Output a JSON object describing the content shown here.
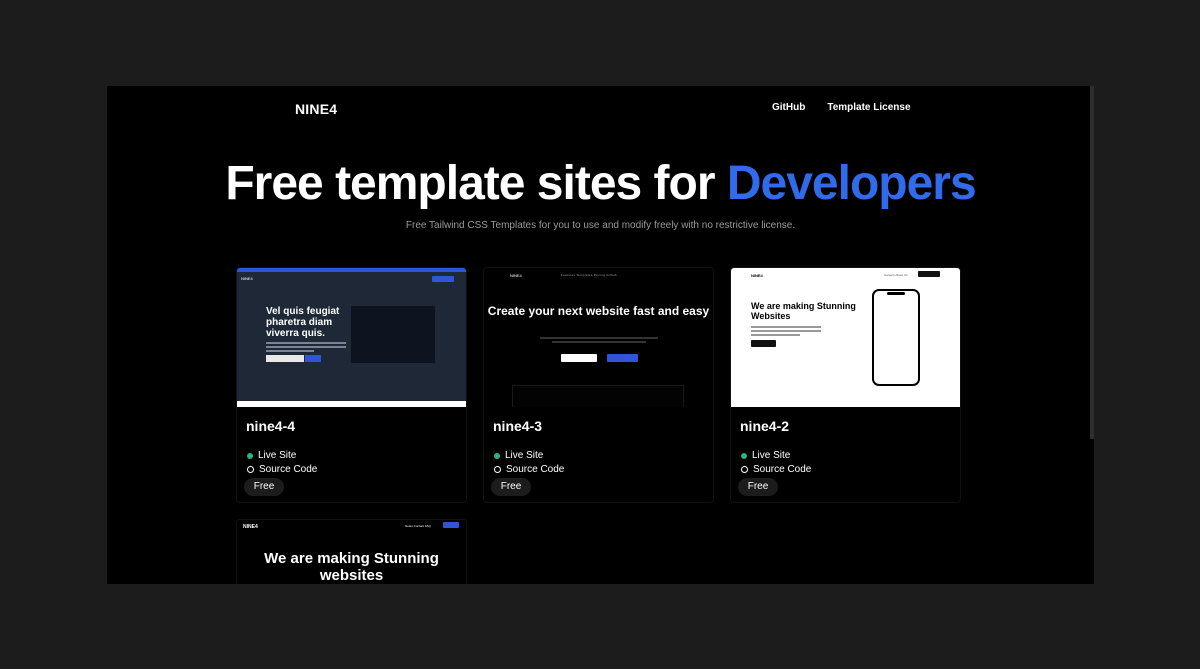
{
  "header": {
    "logo": "NINE4",
    "nav": [
      "GitHub",
      "Template License"
    ]
  },
  "hero": {
    "title_part1": "Free template sites for ",
    "title_accent": "Developers",
    "subtitle": "Free Tailwind CSS Templates for you to use and modify freely with no restrictive license."
  },
  "cards": [
    {
      "title": "nine4-4",
      "live_label": "Live Site",
      "source_label": "Source Code",
      "badge": "Free",
      "thumb": {
        "logo": "NINE4",
        "headline": "Vel quis feugiat pharetra diam viverra quis."
      }
    },
    {
      "title": "nine4-3",
      "live_label": "Live Site",
      "source_label": "Source Code",
      "badge": "Free",
      "thumb": {
        "logo": "NINE4",
        "nav": "Features   Templates   Pricing   Github",
        "headline": "Create your next website fast and easy"
      }
    },
    {
      "title": "nine4-2",
      "live_label": "Live Site",
      "source_label": "Source Code",
      "badge": "Free",
      "thumb": {
        "logo": "NINE4",
        "nav": "Careers   About Us",
        "headline": "We are making Stunning Websites"
      }
    },
    {
      "thumb": {
        "logo": "NINE4",
        "nav": "Notes   Contact   FAQ",
        "headline": "We are making Stunning websites"
      }
    }
  ],
  "colors": {
    "accent": "#2f6bea",
    "live_dot": "#2bb389",
    "background": "#000000"
  }
}
